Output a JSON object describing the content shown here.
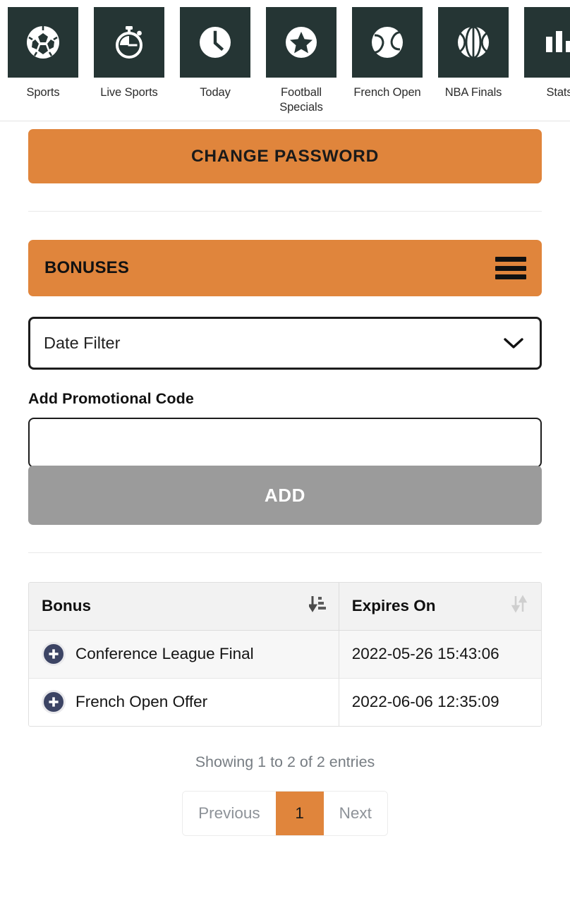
{
  "nav": {
    "items": [
      {
        "label": "Sports",
        "icon": "soccer-ball-icon"
      },
      {
        "label": "Live Sports",
        "icon": "stopwatch-icon"
      },
      {
        "label": "Today",
        "icon": "clock-icon"
      },
      {
        "label": "Football Specials",
        "icon": "star-circle-icon"
      },
      {
        "label": "French Open",
        "icon": "tennis-ball-icon"
      },
      {
        "label": "NBA Finals",
        "icon": "basketball-icon"
      },
      {
        "label": "Stats",
        "icon": "bar-chart-icon"
      }
    ]
  },
  "account": {
    "change_password_label": "CHANGE PASSWORD"
  },
  "bonuses": {
    "header_title": "BONUSES",
    "menu_icon": "hamburger-icon",
    "date_filter_label": "Date Filter",
    "date_filter_chevron": "chevron-down-icon",
    "promo_label": "Add Promotional Code",
    "promo_value": "",
    "promo_placeholder": "",
    "add_label": "ADD"
  },
  "table": {
    "columns": [
      {
        "label": "Bonus",
        "sort_icon": "sort-amount-down-icon",
        "sort_state": "descending"
      },
      {
        "label": "Expires On",
        "sort_icon": "sort-updown-icon",
        "sort_state": "none"
      }
    ],
    "rows": [
      {
        "action_icon": "plus-circle-icon",
        "bonus": "Conference League Final",
        "expires_on": "2022-05-26 15:43:06"
      },
      {
        "action_icon": "plus-circle-icon",
        "bonus": "French Open Offer",
        "expires_on": "2022-06-06 12:35:09"
      }
    ],
    "showing_text": "Showing 1 to 2 of 2 entries"
  },
  "pagination": {
    "previous_label": "Previous",
    "next_label": "Next",
    "current_page": "1"
  },
  "colors": {
    "accent_orange": "#e0853c",
    "tile_dark": "#253534",
    "add_button_gray": "#9b9b9b",
    "badge_navy": "#3c4464"
  }
}
